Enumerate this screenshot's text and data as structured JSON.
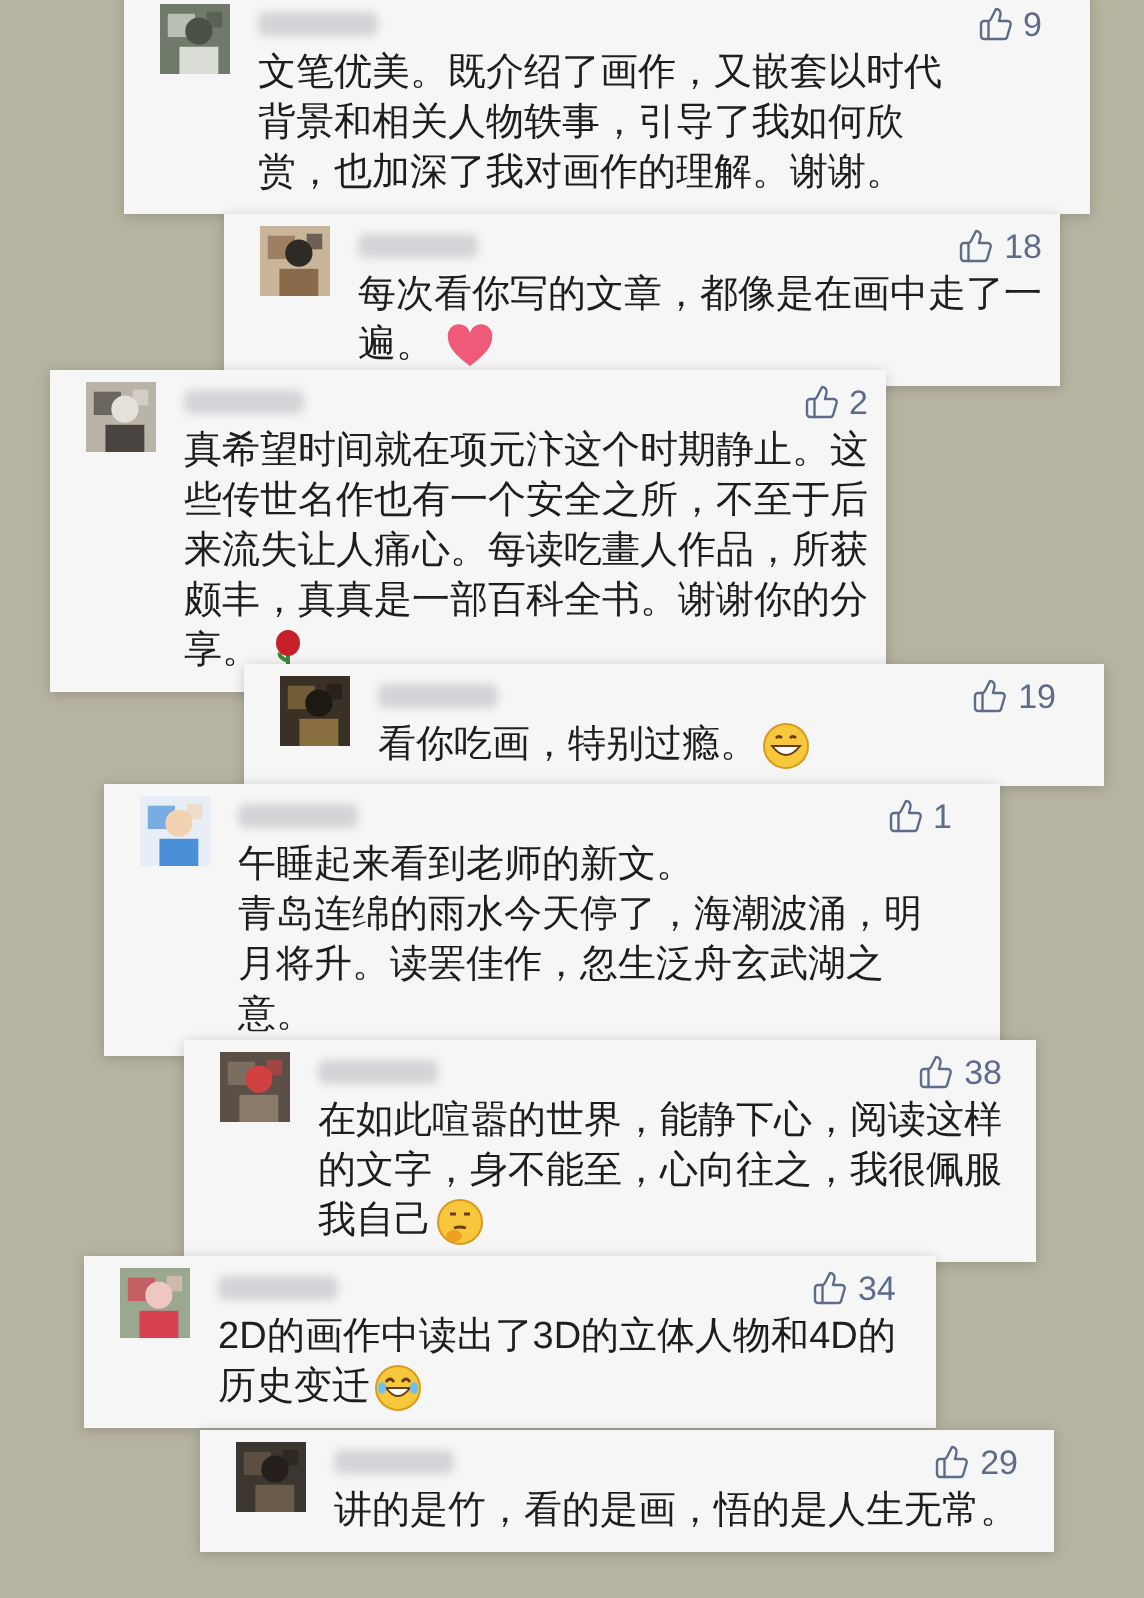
{
  "comments": [
    {
      "likes": "9",
      "lines": [
        "文笔优美。既介绍了画作，又嵌套以时代",
        "背景和相关人物轶事，引导了我如何欣",
        "赏，也加深了我对画作的理解。谢谢。"
      ]
    },
    {
      "likes": "18",
      "lines": [
        "每次看你写的文章，都像是在画中走了一",
        "遍。"
      ],
      "emoji": {
        "kind": "heart"
      }
    },
    {
      "likes": "2",
      "lines": [
        "真希望时间就在项元汴这个时期静止。这",
        "些传世名作也有一个安全之所，不至于后",
        "来流失让人痛心。每读吃畫人作品，所获",
        "颇丰，真真是一部百科全书。谢谢你的分",
        "享。"
      ],
      "emoji": {
        "kind": "rose"
      }
    },
    {
      "likes": "19",
      "lines": [
        "看你吃画，特别过瘾。"
      ],
      "emoji": {
        "kind": "grin"
      }
    },
    {
      "likes": "1",
      "lines": [
        "午睡起来看到老师的新文。",
        "青岛连绵的雨水今天停了，海潮波涌，明",
        "月将升。读罢佳作，忽生泛舟玄武湖之",
        "意。"
      ]
    },
    {
      "likes": "38",
      "lines": [
        "在如此喧嚣的世界，能静下心，阅读这样",
        "的文字，身不能至，心向往之，我很佩服",
        "我自己"
      ],
      "emoji": {
        "kind": "thinking"
      }
    },
    {
      "likes": "34",
      "lines": [
        "2D的画作中读出了3D的立体人物和4D的",
        "历史变迁"
      ],
      "emoji": {
        "kind": "laugh"
      }
    },
    {
      "likes": "29",
      "lines": [
        "讲的是竹，看的是画，悟的是人生无常。"
      ]
    }
  ]
}
